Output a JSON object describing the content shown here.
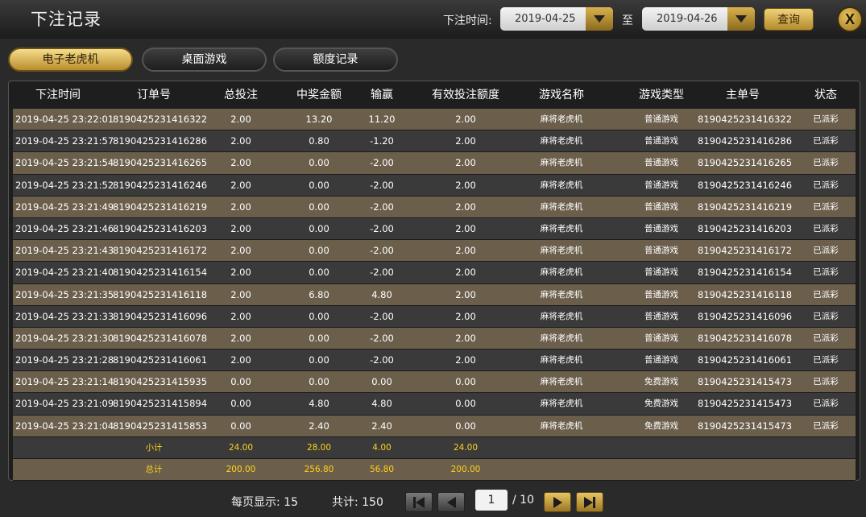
{
  "header": {
    "title": "下注记录",
    "filter_label": "下注时间:",
    "date_from": "2019-04-25",
    "to_label": "至",
    "date_to": "2019-04-26",
    "query_label": "查询",
    "close_label": "X"
  },
  "tabs": [
    {
      "label": "电子老虎机",
      "active": true
    },
    {
      "label": "桌面游戏",
      "active": false
    },
    {
      "label": "额度记录",
      "active": false
    }
  ],
  "columns": [
    "下注时间",
    "订单号",
    "总投注",
    "中奖金额",
    "输赢",
    "有效投注额度",
    "游戏名称",
    "游戏类型",
    "主单号",
    "状态"
  ],
  "rows": [
    [
      "2019-04-25 23:22:01",
      "8190425231416322",
      "2.00",
      "13.20",
      "11.20",
      "2.00",
      "麻将老虎机",
      "普通游戏",
      "8190425231416322",
      "已派彩"
    ],
    [
      "2019-04-25 23:21:57",
      "8190425231416286",
      "2.00",
      "0.80",
      "-1.20",
      "2.00",
      "麻将老虎机",
      "普通游戏",
      "8190425231416286",
      "已派彩"
    ],
    [
      "2019-04-25 23:21:54",
      "8190425231416265",
      "2.00",
      "0.00",
      "-2.00",
      "2.00",
      "麻将老虎机",
      "普通游戏",
      "8190425231416265",
      "已派彩"
    ],
    [
      "2019-04-25 23:21:52",
      "8190425231416246",
      "2.00",
      "0.00",
      "-2.00",
      "2.00",
      "麻将老虎机",
      "普通游戏",
      "8190425231416246",
      "已派彩"
    ],
    [
      "2019-04-25 23:21:49",
      "8190425231416219",
      "2.00",
      "0.00",
      "-2.00",
      "2.00",
      "麻将老虎机",
      "普通游戏",
      "8190425231416219",
      "已派彩"
    ],
    [
      "2019-04-25 23:21:46",
      "8190425231416203",
      "2.00",
      "0.00",
      "-2.00",
      "2.00",
      "麻将老虎机",
      "普通游戏",
      "8190425231416203",
      "已派彩"
    ],
    [
      "2019-04-25 23:21:43",
      "8190425231416172",
      "2.00",
      "0.00",
      "-2.00",
      "2.00",
      "麻将老虎机",
      "普通游戏",
      "8190425231416172",
      "已派彩"
    ],
    [
      "2019-04-25 23:21:40",
      "8190425231416154",
      "2.00",
      "0.00",
      "-2.00",
      "2.00",
      "麻将老虎机",
      "普通游戏",
      "8190425231416154",
      "已派彩"
    ],
    [
      "2019-04-25 23:21:35",
      "8190425231416118",
      "2.00",
      "6.80",
      "4.80",
      "2.00",
      "麻将老虎机",
      "普通游戏",
      "8190425231416118",
      "已派彩"
    ],
    [
      "2019-04-25 23:21:33",
      "8190425231416096",
      "2.00",
      "0.00",
      "-2.00",
      "2.00",
      "麻将老虎机",
      "普通游戏",
      "8190425231416096",
      "已派彩"
    ],
    [
      "2019-04-25 23:21:30",
      "8190425231416078",
      "2.00",
      "0.00",
      "-2.00",
      "2.00",
      "麻将老虎机",
      "普通游戏",
      "8190425231416078",
      "已派彩"
    ],
    [
      "2019-04-25 23:21:28",
      "8190425231416061",
      "2.00",
      "0.00",
      "-2.00",
      "2.00",
      "麻将老虎机",
      "普通游戏",
      "8190425231416061",
      "已派彩"
    ],
    [
      "2019-04-25 23:21:14",
      "8190425231415935",
      "0.00",
      "0.00",
      "0.00",
      "0.00",
      "麻将老虎机",
      "免费游戏",
      "8190425231415473",
      "已派彩"
    ],
    [
      "2019-04-25 23:21:09",
      "8190425231415894",
      "0.00",
      "4.80",
      "4.80",
      "0.00",
      "麻将老虎机",
      "免费游戏",
      "8190425231415473",
      "已派彩"
    ],
    [
      "2019-04-25 23:21:04",
      "8190425231415853",
      "0.00",
      "2.40",
      "2.40",
      "0.00",
      "麻将老虎机",
      "免费游戏",
      "8190425231415473",
      "已派彩"
    ]
  ],
  "subtotal": {
    "label": "小计",
    "total_bet": "24.00",
    "win": "28.00",
    "net": "4.00",
    "valid": "24.00"
  },
  "total": {
    "label": "总计",
    "total_bet": "200.00",
    "win": "256.80",
    "net": "56.80",
    "valid": "200.00"
  },
  "pagination": {
    "per_page_label": "每页显示: 15",
    "total_label": "共计: 150",
    "current_page": "1",
    "total_pages": "/ 10"
  }
}
